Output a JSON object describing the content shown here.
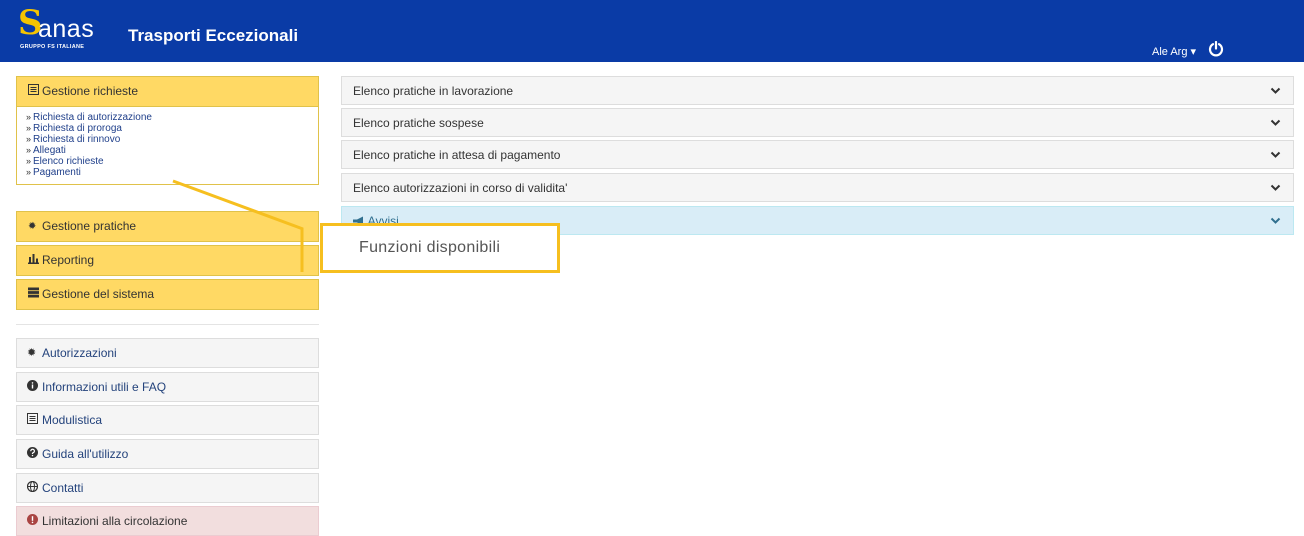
{
  "header": {
    "logo_text": "anas",
    "logo_subtext": "GRUPPO FS ITALIANE",
    "app_title": "Trasporti Eccezionali",
    "user_name": "Ale Arg",
    "user_caret": "▾",
    "power_icon": "power-icon"
  },
  "sidebar": {
    "gestione_richieste": {
      "label": "Gestione richieste",
      "icon": "list-icon",
      "links": [
        "Richiesta di autorizzazione",
        "Richiesta di proroga",
        "Richiesta di rinnovo",
        "Allegati",
        "Elenco richieste",
        "Pagamenti"
      ]
    },
    "gestione_pratiche": {
      "label": "Gestione pratiche",
      "icon": "cog-icon"
    },
    "reporting": {
      "label": "Reporting",
      "icon": "bar-chart-icon"
    },
    "gestione_sistema": {
      "label": "Gestione del sistema",
      "icon": "server-icon"
    },
    "info_items": [
      {
        "label": "Autorizzazioni",
        "icon": "cog-icon"
      },
      {
        "label": "Informazioni utili e FAQ",
        "icon": "info-icon"
      },
      {
        "label": "Modulistica",
        "icon": "list-icon"
      },
      {
        "label": "Guida all'utilizzo",
        "icon": "question-icon"
      },
      {
        "label": "Contatti",
        "icon": "globe-icon"
      },
      {
        "label": "Limitazioni alla circolazione",
        "icon": "alert-icon"
      }
    ]
  },
  "main": {
    "panels": [
      "Elenco pratiche in lavorazione",
      "Elenco pratiche sospese",
      "Elenco pratiche in attesa di pagamento",
      "Elenco autorizzazioni in corso di validita'",
      "Avvisi"
    ]
  },
  "callout": {
    "label": "Funzioni disponibili"
  },
  "colors": {
    "header_bg": "#0a3ba6",
    "accent_yellow": "#ffd964",
    "callout_border": "#f6bf1f",
    "info_panel_bg": "#d9edf7",
    "alert_bg": "#f2dede"
  }
}
